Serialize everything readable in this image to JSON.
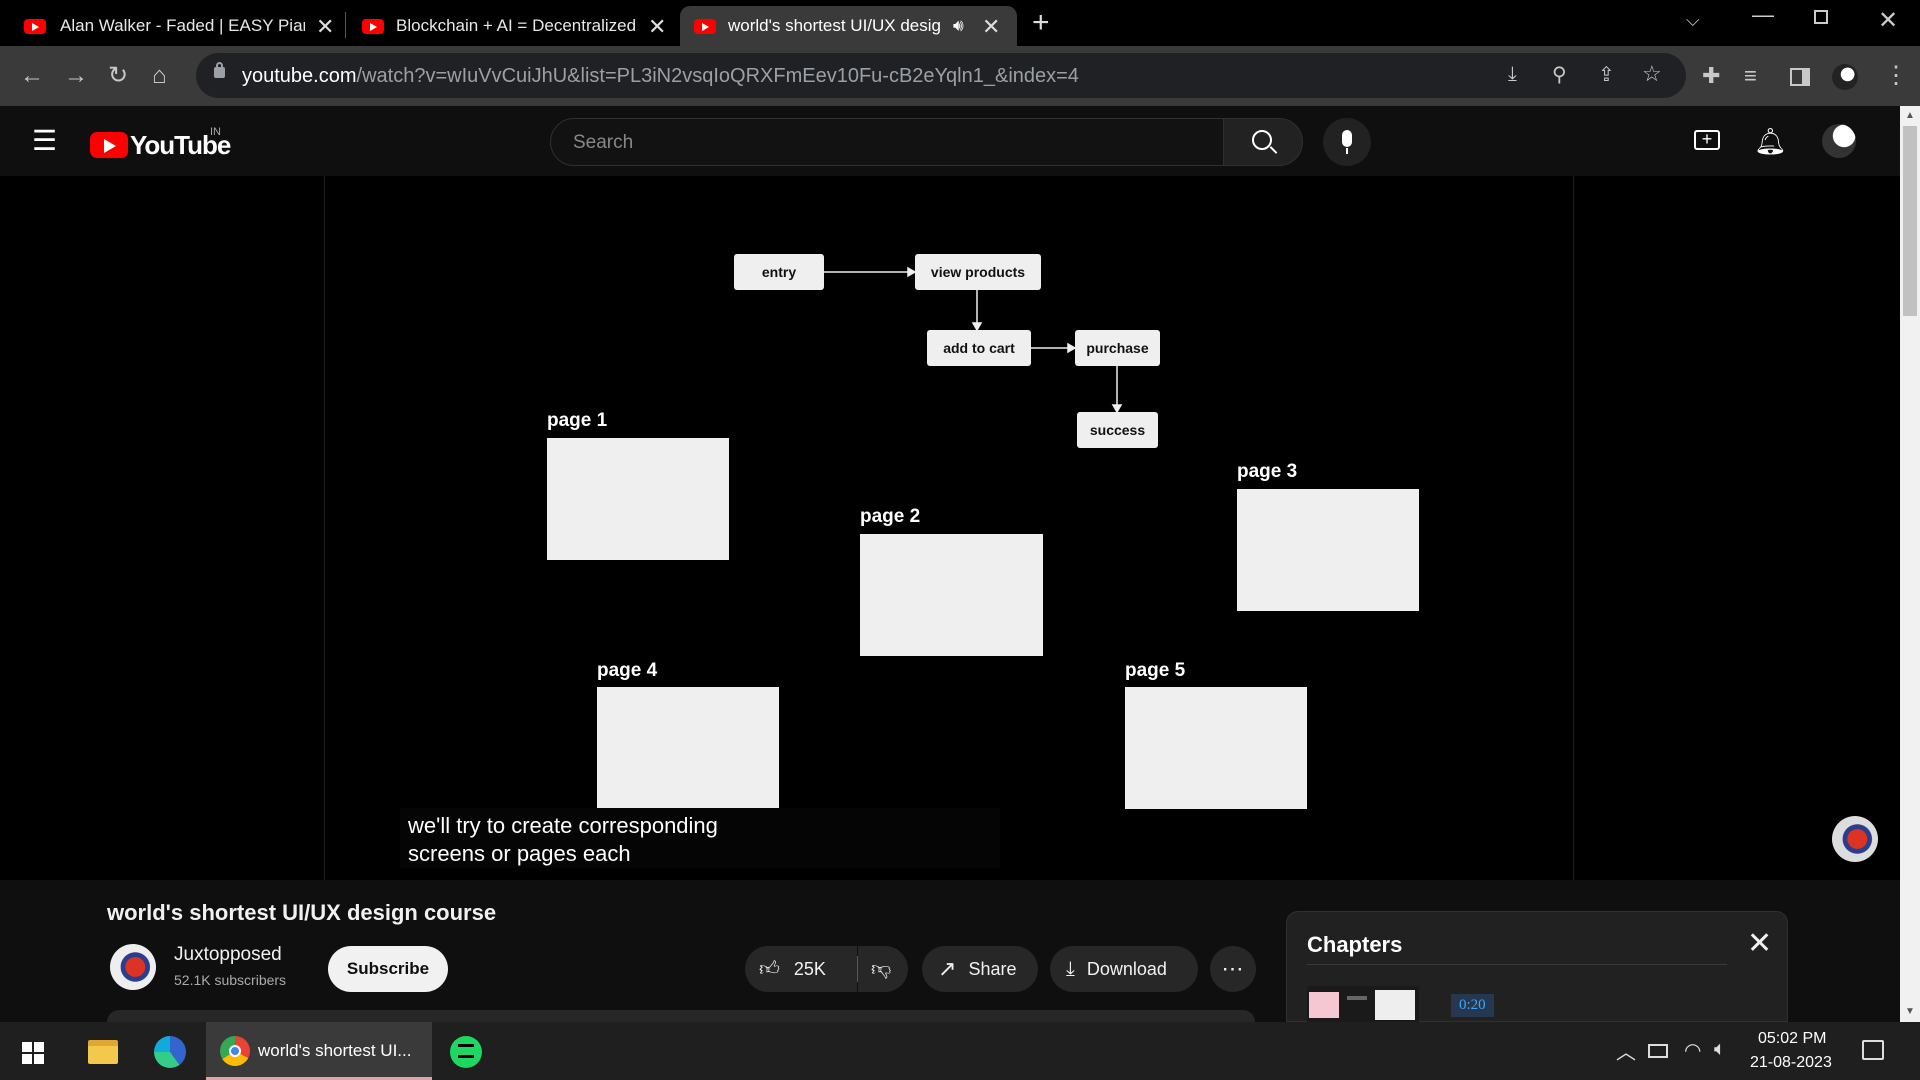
{
  "browser": {
    "tabs": [
      {
        "title": "Alan Walker - Faded | EASY Piano",
        "active": false
      },
      {
        "title": "Blockchain + AI = Decentralized",
        "active": false
      },
      {
        "title": "world's shortest UI/UX design",
        "active": true
      }
    ],
    "url_host": "youtube.com",
    "url_rest": "/watch?v=wIuVvCuiJhU&list=PL3iN2vsqIoQRXFmEev10Fu-cB2eYqln1_&index=4"
  },
  "youtube": {
    "logo_text": "YouTube",
    "region": "IN",
    "search_placeholder": "Search"
  },
  "video": {
    "flow_nodes": [
      "entry",
      "view products",
      "add to cart",
      "purchase",
      "success"
    ],
    "pages": [
      "page 1",
      "page 2",
      "page 3",
      "page 4",
      "page 5"
    ],
    "caption_line1": "we'll try to create corresponding",
    "caption_line2": "screens or pages each"
  },
  "meta": {
    "title": "world's shortest UI/UX design course",
    "channel": "Juxtopposed",
    "subscribers": "52.1K subscribers",
    "subscribe_label": "Subscribe",
    "likes": "25K",
    "share_label": "Share",
    "download_label": "Download"
  },
  "chapters": {
    "heading": "Chapters",
    "time": "0:20"
  },
  "taskbar": {
    "app_label": "world's shortest UI...",
    "time": "05:02 PM",
    "date": "21-08-2023"
  },
  "colors": {
    "youtube_red": "#ff0000",
    "spotify_green": "#1ed760",
    "chapter_time_bg": "#263850"
  }
}
